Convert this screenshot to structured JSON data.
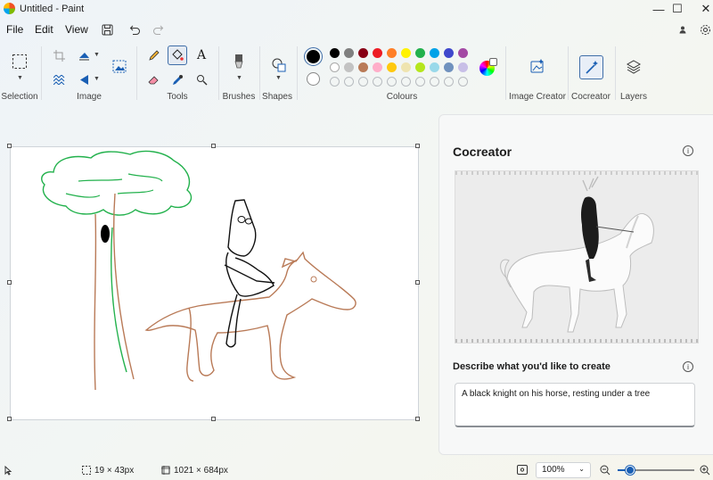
{
  "window": {
    "title": "Untitled - Paint",
    "minimize": "—",
    "maximize": "☐",
    "close": "✕"
  },
  "menu": {
    "file": "File",
    "edit": "Edit",
    "view": "View"
  },
  "ribbon": {
    "groups": {
      "selection": "Selection",
      "image": "Image",
      "tools": "Tools",
      "brushes": "Brushes",
      "shapes": "Shapes",
      "colours": "Colours",
      "image_creator": "Image Creator",
      "cocreator": "Cocreator",
      "layers": "Layers"
    },
    "tool_glyphs": {
      "text": "A"
    },
    "palette": {
      "row1": [
        "#000000",
        "#7f7f7f",
        "#880015",
        "#ed1c24",
        "#ff7f27",
        "#fff200",
        "#22b14c",
        "#00a2e8",
        "#3f48cc",
        "#a349a4"
      ],
      "row2": [
        "#ffffff",
        "#c3c3c3",
        "#b97a57",
        "#ffaec9",
        "#ffc90e",
        "#efe4b0",
        "#b5e61d",
        "#99d9ea",
        "#7092be",
        "#c8bfe7"
      ],
      "row3": [
        "empty",
        "empty",
        "empty",
        "empty",
        "empty",
        "empty",
        "empty",
        "empty",
        "empty",
        "empty"
      ],
      "primary": "#000000",
      "secondary": "#ffffff"
    }
  },
  "cocreator": {
    "title": "Cocreator",
    "prompt_label": "Describe what you'd like to create",
    "prompt_value": "A black knight on his horse, resting under a tree"
  },
  "status": {
    "selection_size": "19 × 43px",
    "canvas_size": "1021 × 684px",
    "zoom": "100%",
    "zoom_fraction": 0.15
  },
  "icons": [
    "app-icon",
    "save-icon",
    "undo-icon",
    "redo-icon",
    "account-icon",
    "settings-icon",
    "select-icon",
    "crop-icon",
    "resize-icon",
    "rotate-icon",
    "flip-icon",
    "image-select-icon",
    "pencil-icon",
    "fill-icon",
    "text-icon",
    "eraser-icon",
    "color-picker-icon",
    "magnifier-icon",
    "brush-icon",
    "shapes-icon",
    "edit-colours-icon",
    "image-creator-icon",
    "cocreator-icon",
    "layers-icon",
    "info-icon",
    "cursor-icon",
    "selection-size-icon",
    "canvas-size-icon",
    "fit-icon",
    "zoom-out-icon",
    "zoom-in-icon"
  ]
}
